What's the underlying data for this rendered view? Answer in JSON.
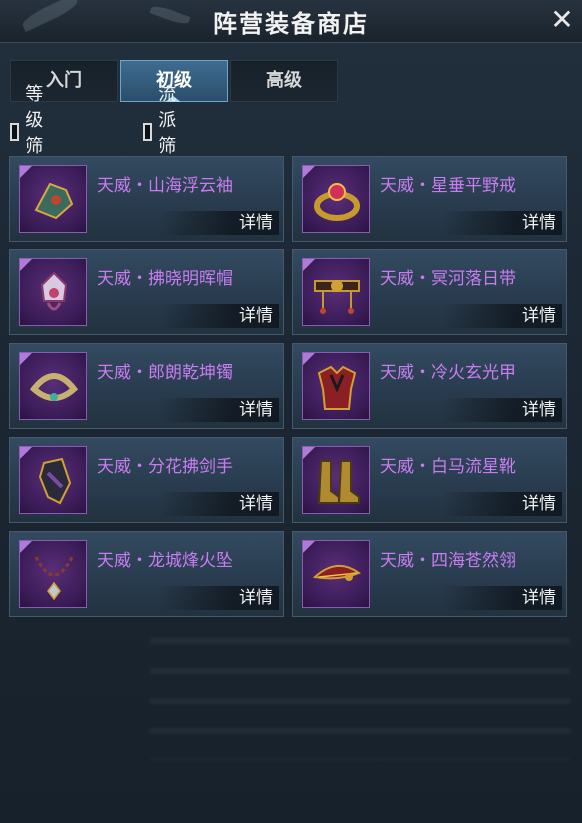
{
  "window": {
    "title": "阵营装备商店"
  },
  "tabs": [
    {
      "label": "入门",
      "active": false
    },
    {
      "label": "初级",
      "active": true
    },
    {
      "label": "高级",
      "active": false
    }
  ],
  "filters": [
    {
      "label": "等级筛选",
      "checked": false
    },
    {
      "label": "流派筛选",
      "checked": false
    }
  ],
  "items": [
    {
      "name": "天威・山海浮云袖",
      "detail": "详情",
      "icon": "bracer-icon"
    },
    {
      "name": "天威・星垂平野戒",
      "detail": "详情",
      "icon": "ring-icon"
    },
    {
      "name": "天威・拂晓明晖帽",
      "detail": "详情",
      "icon": "hat-icon"
    },
    {
      "name": "天威・冥河落日带",
      "detail": "详情",
      "icon": "belt-icon"
    },
    {
      "name": "天威・郎朗乾坤镯",
      "detail": "详情",
      "icon": "bracelet-icon"
    },
    {
      "name": "天威・冷火玄光甲",
      "detail": "详情",
      "icon": "armor-icon"
    },
    {
      "name": "天威・分花拂剑手",
      "detail": "详情",
      "icon": "glove-icon"
    },
    {
      "name": "天威・白马流星靴",
      "detail": "详情",
      "icon": "boots-icon"
    },
    {
      "name": "天威・龙城烽火坠",
      "detail": "详情",
      "icon": "pendant-icon"
    },
    {
      "name": "天威・四海苍然翎",
      "detail": "详情",
      "icon": "feather-icon"
    }
  ],
  "colors": {
    "item_name": "#c97cf0",
    "tab_active": "#3f6c90",
    "background": "#1c2834"
  }
}
